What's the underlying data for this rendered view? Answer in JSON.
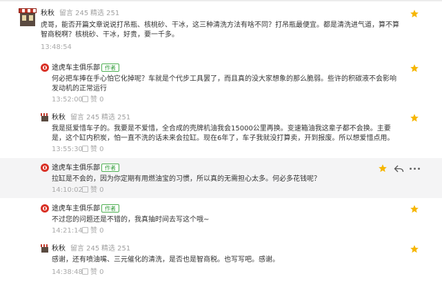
{
  "comments": [
    {
      "author": "秋秋",
      "messages": "留言 245",
      "featured": "精选 251",
      "text": "虎哥，能否开篇文章说说打吊瓶、核桃砂、干冰，这三种清洗方法有啥不同？打吊瓶最便宜。都是清洗进气道，算不算智商税啊？核桃砂、干冰，好贵，要一千多。",
      "time": "13:48:54"
    },
    {
      "author": "途虎车主俱乐部",
      "badge": "作者",
      "text": "何必把车捧在手心怕它化掉呢？车就是个代步工具罢了，而且真的没大家想象的那么脆弱。些许的积碳液不会影响发动机的正常运行",
      "time": "13:52:00",
      "likes": "赞 0"
    },
    {
      "author": "秋秋",
      "messages": "留言 245",
      "featured": "精选 251",
      "text": "我是挺爱惜车子的。我要是不爱惜，全合成的壳牌机油我会15000公里再换。变速箱油我这辈子都不会换。主要是，这个缸内积炭，怕一直不洗的话未来会拉缸。现在6年了，车子我就没打算卖，开到报废。所以想爱惜点用。",
      "time": "13:55:30",
      "likes": "赞 0"
    },
    {
      "author": "途虎车主俱乐部",
      "badge": "作者",
      "text": "拉缸是不会的，因为你定期有用燃油宝的习惯，所以真的无需担心太多。何必多花钱呢？",
      "time": "14:10:02",
      "likes": "赞 0"
    },
    {
      "author": "途虎车主俱乐部",
      "badge": "作者",
      "text": "不过您的问题还是不错的，我真抽时间去写这个哦~",
      "time": "14:21:14",
      "likes": "赞 0"
    },
    {
      "author": "秋秋",
      "messages": "留言 245",
      "featured": "精选 251",
      "text": "感谢，还有喷油嘴、三元催化的清洗，是否也是智商税。也写写吧。感谢。",
      "time": "14:38:48",
      "likes": "赞 0"
    }
  ],
  "colors": {
    "star": "#f6b600",
    "highlight_bg": "#f4f4f5",
    "badge": "#4caf50"
  },
  "icons": [
    "star-icon",
    "reply-icon",
    "more-icon",
    "thumb-up-icon"
  ]
}
